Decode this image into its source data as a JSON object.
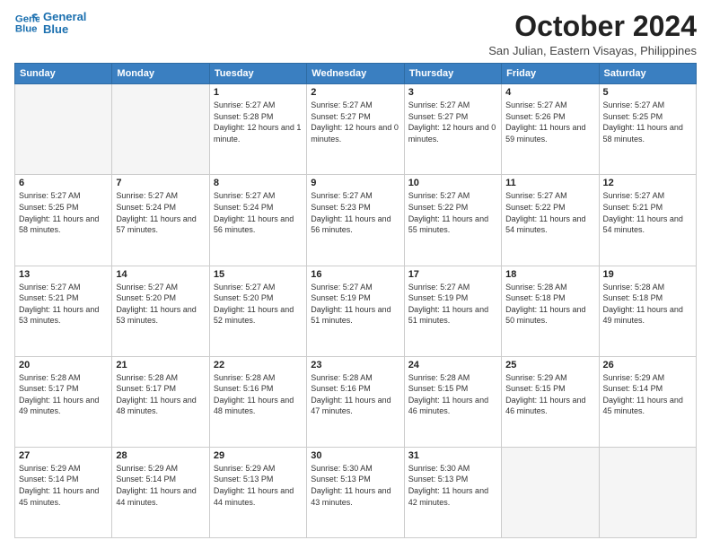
{
  "header": {
    "logo_line1": "General",
    "logo_line2": "Blue",
    "month": "October 2024",
    "location": "San Julian, Eastern Visayas, Philippines"
  },
  "weekdays": [
    "Sunday",
    "Monday",
    "Tuesday",
    "Wednesday",
    "Thursday",
    "Friday",
    "Saturday"
  ],
  "weeks": [
    [
      {
        "day": "",
        "info": ""
      },
      {
        "day": "",
        "info": ""
      },
      {
        "day": "1",
        "info": "Sunrise: 5:27 AM\nSunset: 5:28 PM\nDaylight: 12 hours and 1 minute."
      },
      {
        "day": "2",
        "info": "Sunrise: 5:27 AM\nSunset: 5:27 PM\nDaylight: 12 hours and 0 minutes."
      },
      {
        "day": "3",
        "info": "Sunrise: 5:27 AM\nSunset: 5:27 PM\nDaylight: 12 hours and 0 minutes."
      },
      {
        "day": "4",
        "info": "Sunrise: 5:27 AM\nSunset: 5:26 PM\nDaylight: 11 hours and 59 minutes."
      },
      {
        "day": "5",
        "info": "Sunrise: 5:27 AM\nSunset: 5:25 PM\nDaylight: 11 hours and 58 minutes."
      }
    ],
    [
      {
        "day": "6",
        "info": "Sunrise: 5:27 AM\nSunset: 5:25 PM\nDaylight: 11 hours and 58 minutes."
      },
      {
        "day": "7",
        "info": "Sunrise: 5:27 AM\nSunset: 5:24 PM\nDaylight: 11 hours and 57 minutes."
      },
      {
        "day": "8",
        "info": "Sunrise: 5:27 AM\nSunset: 5:24 PM\nDaylight: 11 hours and 56 minutes."
      },
      {
        "day": "9",
        "info": "Sunrise: 5:27 AM\nSunset: 5:23 PM\nDaylight: 11 hours and 56 minutes."
      },
      {
        "day": "10",
        "info": "Sunrise: 5:27 AM\nSunset: 5:22 PM\nDaylight: 11 hours and 55 minutes."
      },
      {
        "day": "11",
        "info": "Sunrise: 5:27 AM\nSunset: 5:22 PM\nDaylight: 11 hours and 54 minutes."
      },
      {
        "day": "12",
        "info": "Sunrise: 5:27 AM\nSunset: 5:21 PM\nDaylight: 11 hours and 54 minutes."
      }
    ],
    [
      {
        "day": "13",
        "info": "Sunrise: 5:27 AM\nSunset: 5:21 PM\nDaylight: 11 hours and 53 minutes."
      },
      {
        "day": "14",
        "info": "Sunrise: 5:27 AM\nSunset: 5:20 PM\nDaylight: 11 hours and 53 minutes."
      },
      {
        "day": "15",
        "info": "Sunrise: 5:27 AM\nSunset: 5:20 PM\nDaylight: 11 hours and 52 minutes."
      },
      {
        "day": "16",
        "info": "Sunrise: 5:27 AM\nSunset: 5:19 PM\nDaylight: 11 hours and 51 minutes."
      },
      {
        "day": "17",
        "info": "Sunrise: 5:27 AM\nSunset: 5:19 PM\nDaylight: 11 hours and 51 minutes."
      },
      {
        "day": "18",
        "info": "Sunrise: 5:28 AM\nSunset: 5:18 PM\nDaylight: 11 hours and 50 minutes."
      },
      {
        "day": "19",
        "info": "Sunrise: 5:28 AM\nSunset: 5:18 PM\nDaylight: 11 hours and 49 minutes."
      }
    ],
    [
      {
        "day": "20",
        "info": "Sunrise: 5:28 AM\nSunset: 5:17 PM\nDaylight: 11 hours and 49 minutes."
      },
      {
        "day": "21",
        "info": "Sunrise: 5:28 AM\nSunset: 5:17 PM\nDaylight: 11 hours and 48 minutes."
      },
      {
        "day": "22",
        "info": "Sunrise: 5:28 AM\nSunset: 5:16 PM\nDaylight: 11 hours and 48 minutes."
      },
      {
        "day": "23",
        "info": "Sunrise: 5:28 AM\nSunset: 5:16 PM\nDaylight: 11 hours and 47 minutes."
      },
      {
        "day": "24",
        "info": "Sunrise: 5:28 AM\nSunset: 5:15 PM\nDaylight: 11 hours and 46 minutes."
      },
      {
        "day": "25",
        "info": "Sunrise: 5:29 AM\nSunset: 5:15 PM\nDaylight: 11 hours and 46 minutes."
      },
      {
        "day": "26",
        "info": "Sunrise: 5:29 AM\nSunset: 5:14 PM\nDaylight: 11 hours and 45 minutes."
      }
    ],
    [
      {
        "day": "27",
        "info": "Sunrise: 5:29 AM\nSunset: 5:14 PM\nDaylight: 11 hours and 45 minutes."
      },
      {
        "day": "28",
        "info": "Sunrise: 5:29 AM\nSunset: 5:14 PM\nDaylight: 11 hours and 44 minutes."
      },
      {
        "day": "29",
        "info": "Sunrise: 5:29 AM\nSunset: 5:13 PM\nDaylight: 11 hours and 44 minutes."
      },
      {
        "day": "30",
        "info": "Sunrise: 5:30 AM\nSunset: 5:13 PM\nDaylight: 11 hours and 43 minutes."
      },
      {
        "day": "31",
        "info": "Sunrise: 5:30 AM\nSunset: 5:13 PM\nDaylight: 11 hours and 42 minutes."
      },
      {
        "day": "",
        "info": ""
      },
      {
        "day": "",
        "info": ""
      }
    ]
  ]
}
